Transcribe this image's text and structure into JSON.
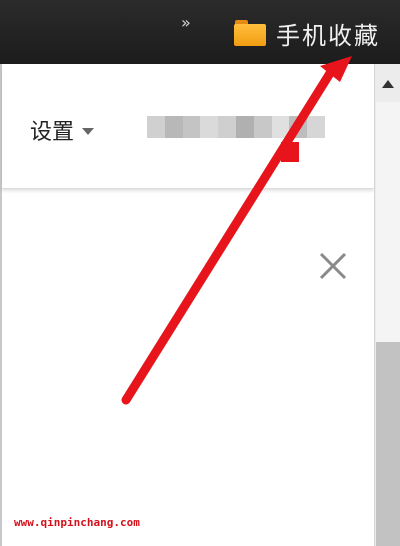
{
  "topbar": {
    "overflow_chevron": "»",
    "bookmark": {
      "icon": "folder-icon",
      "label": "手机收藏"
    }
  },
  "header": {
    "settings_label": "设置",
    "settings_icon": "caret-down-icon",
    "blurred_text_colors": [
      "#d0d0d0",
      "#b8b8b8",
      "#c4c4c4",
      "#dadada",
      "#cfcfcf",
      "#b0b0b0",
      "#c8c8c8",
      "#e0e0e0",
      "#bdbdbd",
      "#d6d6d6"
    ]
  },
  "dialog": {
    "close_icon": "close-icon"
  },
  "footer": {
    "watermark": "www.qinpinchang.com"
  },
  "annotation": {
    "arrow_color": "#e8141c"
  },
  "colors": {
    "topbar": "#222222",
    "folder": "#f5a623",
    "scroll_thumb": "#c2c2c2"
  }
}
